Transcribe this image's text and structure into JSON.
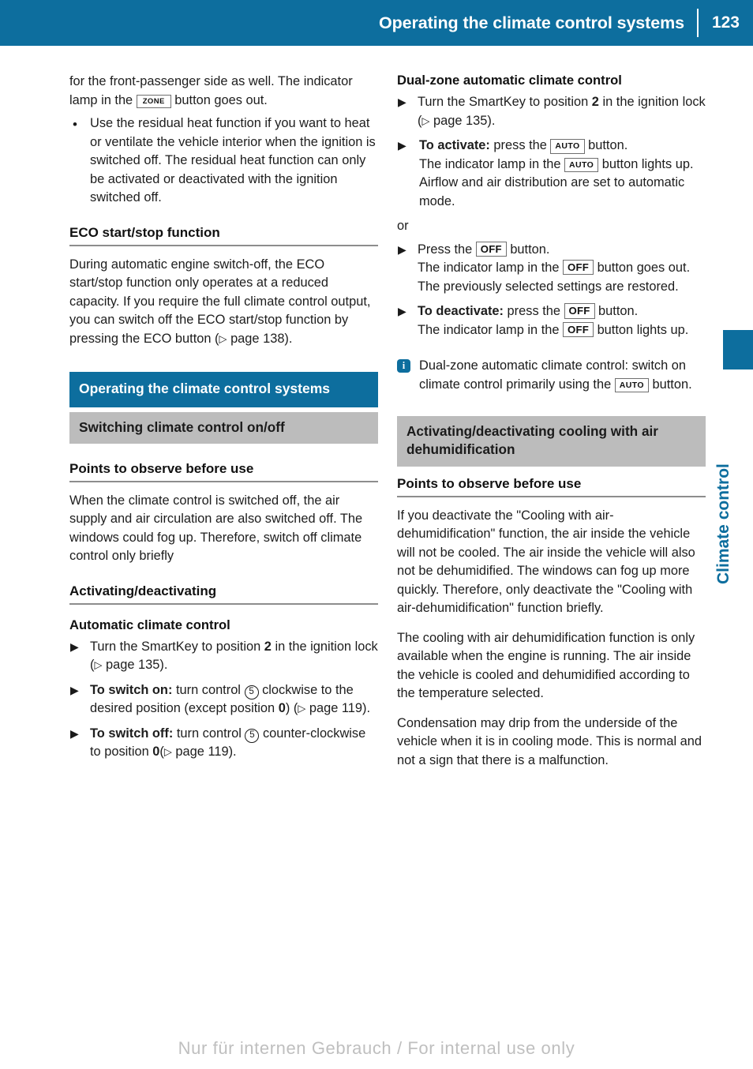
{
  "header": {
    "title": "Operating the climate control systems",
    "page_number": "123"
  },
  "thumb_tab": {
    "label": "Climate control"
  },
  "colors": {
    "brand_blue": "#0d6e9e",
    "gray_band": "#bcbcbc",
    "rule_gray": "#8d8d8d"
  },
  "icons": {
    "zone": "ZONE",
    "auto": "AUTO",
    "off": "OFF",
    "control_5": "5",
    "page_ref_triangle": "▷",
    "step_marker": "▶",
    "bullet_marker": "•",
    "info": "i"
  },
  "left_column": {
    "continued_paragraph": {
      "part1": "for the front-passenger side as well. The indicator lamp in the ",
      "part2": " button goes out."
    },
    "bullet_residual_heat": "Use the residual heat function if you want to heat or ventilate the vehicle interior when the ignition is switched off. The residual heat function can only be activated or deactivated with the ignition switched off.",
    "eco_heading": "ECO start/stop function",
    "eco_paragraph": {
      "part1": "During automatic engine switch-off, the ECO start/stop function only operates at a reduced capacity. If you require the full climate control output, you can switch off the ECO start/stop function by pressing the ECO button (",
      "page_ref": " page 138)."
    },
    "blue_heading": "Operating the climate control systems",
    "gray_heading": "Switching climate control on/off",
    "points_heading": "Points to observe before use",
    "points_paragraph": "When the climate control is switched off, the air supply and air circulation are also switched off. The windows could fog up. Therefore, switch off climate control only briefly",
    "activating_heading": "Activating/deactivating",
    "automatic_heading": "Automatic climate control",
    "steps": {
      "smartkey": {
        "part1": "Turn the SmartKey to position ",
        "position": "2",
        "part2": " in the ignition lock (",
        "page_ref": " page 135)."
      },
      "switch_on": {
        "label": "To switch on:",
        "part1": " turn control ",
        "part2": " clockwise to the desired position (except position ",
        "position": "0",
        "part3": ")",
        "page_ref": " page 119)."
      },
      "switch_off": {
        "label": "To switch off:",
        "part1": " turn control ",
        "part2": " counter-clockwise to position ",
        "position": "0",
        "page_ref": " page 119)."
      }
    }
  },
  "right_column": {
    "dual_zone_heading": "Dual-zone automatic climate control",
    "steps": {
      "smartkey": {
        "part1": "Turn the SmartKey to position ",
        "position": "2",
        "part2": " in the ignition lock (",
        "page_ref": " page 135)."
      },
      "activate": {
        "label": "To activate:",
        "part1": " press the ",
        "part2": " button.",
        "part3": "The indicator lamp in the ",
        "part4": " button lights up. Airflow and air distribution are set to automatic mode."
      },
      "or_separator": "or",
      "press_off": {
        "part1": "Press the ",
        "part2": " button.",
        "part3": "The indicator lamp in the ",
        "part4": " button goes out. The previously selected settings are restored."
      },
      "deactivate": {
        "label": "To deactivate:",
        "part1": " press the ",
        "part2": " button.",
        "part3": "The indicator lamp in the ",
        "part4": " button lights up."
      }
    },
    "note": {
      "part1": "Dual-zone automatic climate control: switch on climate control primarily using the ",
      "part2": " button."
    },
    "gray_heading": "Activating/deactivating cooling with air dehumidification",
    "points_heading": "Points to observe before use",
    "paragraph_1": "If you deactivate the \"Cooling with air-dehumidification\" function, the air inside the vehicle will not be cooled. The air inside the vehicle will also not be dehumidified. The windows can fog up more quickly. Therefore, only deactivate the \"Cooling with air-dehumidification\" function briefly.",
    "paragraph_2": "The cooling with air dehumidification function is only available when the engine is running. The air inside the vehicle is cooled and dehumidified according to the temperature selected.",
    "paragraph_3": "Condensation may drip from the underside of the vehicle when it is in cooling mode. This is normal and not a sign that there is a malfunction."
  },
  "footer": {
    "watermark": "Nur für internen Gebrauch / For internal use only"
  }
}
